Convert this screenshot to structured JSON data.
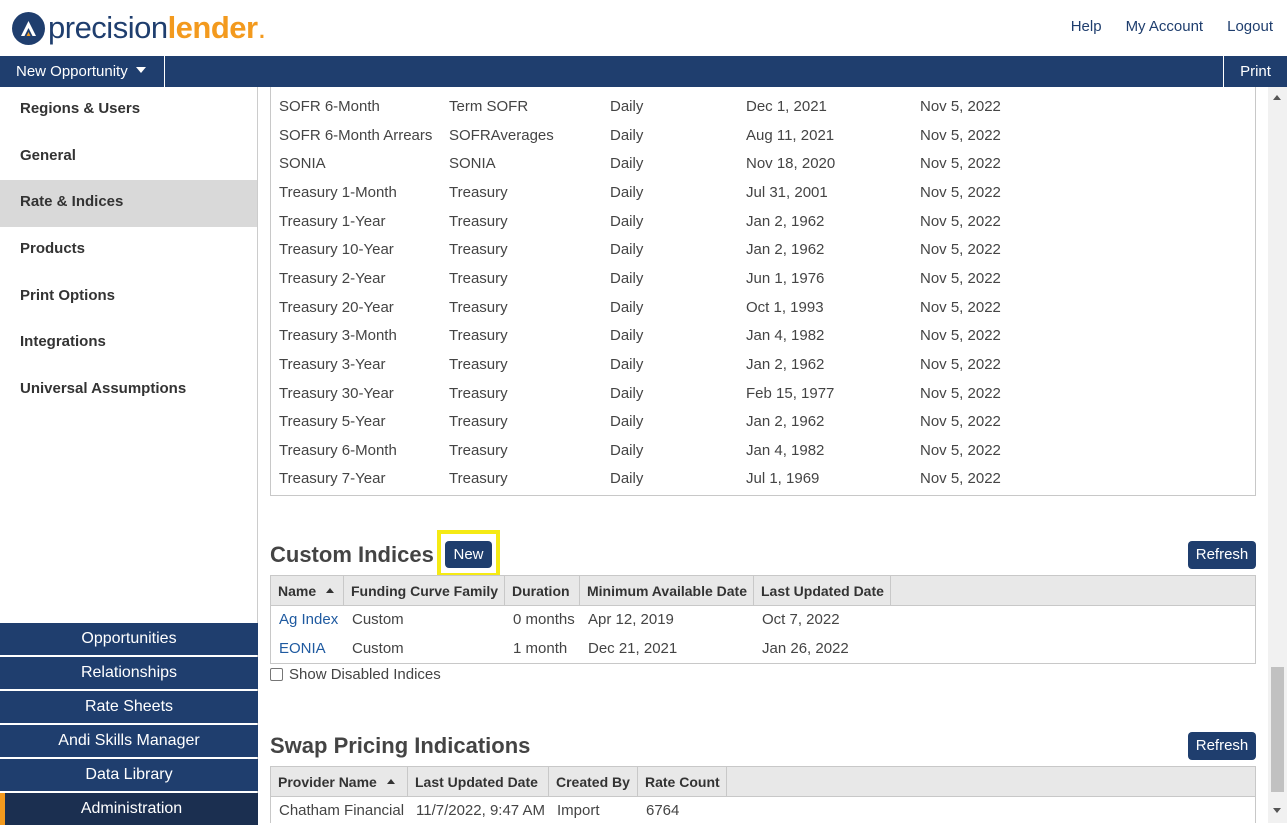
{
  "header": {
    "logo_part1": "precision",
    "logo_part2": "lender",
    "logo_dot": ".",
    "links": [
      "Help",
      "My Account",
      "Logout"
    ]
  },
  "navbar": {
    "opportunity_label": "New Opportunity",
    "print_label": "Print"
  },
  "sidebar": {
    "items": [
      {
        "label": "Regions & Users",
        "active": false
      },
      {
        "label": "General",
        "active": false
      },
      {
        "label": "Rate & Indices",
        "active": true
      },
      {
        "label": "Products",
        "active": false
      },
      {
        "label": "Print Options",
        "active": false
      },
      {
        "label": "Integrations",
        "active": false
      },
      {
        "label": "Universal Assumptions",
        "active": false
      }
    ],
    "bottom_nav": [
      "Opportunities",
      "Relationships",
      "Rate Sheets",
      "Andi Skills Manager",
      "Data Library",
      "Administration"
    ]
  },
  "standard_indices": {
    "rows": [
      [
        "SOFR 6-Month",
        "Term SOFR",
        "Daily",
        "Dec 1, 2021",
        "Nov 5, 2022"
      ],
      [
        "SOFR 6-Month Arrears",
        "SOFRAverages",
        "Daily",
        "Aug 11, 2021",
        "Nov 5, 2022"
      ],
      [
        "SONIA",
        "SONIA",
        "Daily",
        "Nov 18, 2020",
        "Nov 5, 2022"
      ],
      [
        "Treasury 1-Month",
        "Treasury",
        "Daily",
        "Jul 31, 2001",
        "Nov 5, 2022"
      ],
      [
        "Treasury 1-Year",
        "Treasury",
        "Daily",
        "Jan 2, 1962",
        "Nov 5, 2022"
      ],
      [
        "Treasury 10-Year",
        "Treasury",
        "Daily",
        "Jan 2, 1962",
        "Nov 5, 2022"
      ],
      [
        "Treasury 2-Year",
        "Treasury",
        "Daily",
        "Jun 1, 1976",
        "Nov 5, 2022"
      ],
      [
        "Treasury 20-Year",
        "Treasury",
        "Daily",
        "Oct 1, 1993",
        "Nov 5, 2022"
      ],
      [
        "Treasury 3-Month",
        "Treasury",
        "Daily",
        "Jan 4, 1982",
        "Nov 5, 2022"
      ],
      [
        "Treasury 3-Year",
        "Treasury",
        "Daily",
        "Jan 2, 1962",
        "Nov 5, 2022"
      ],
      [
        "Treasury 30-Year",
        "Treasury",
        "Daily",
        "Feb 15, 1977",
        "Nov 5, 2022"
      ],
      [
        "Treasury 5-Year",
        "Treasury",
        "Daily",
        "Jan 2, 1962",
        "Nov 5, 2022"
      ],
      [
        "Treasury 6-Month",
        "Treasury",
        "Daily",
        "Jan 4, 1982",
        "Nov 5, 2022"
      ],
      [
        "Treasury 7-Year",
        "Treasury",
        "Daily",
        "Jul 1, 1969",
        "Nov 5, 2022"
      ]
    ]
  },
  "custom_indices": {
    "title": "Custom Indices",
    "new_label": "New",
    "refresh_label": "Refresh",
    "columns": [
      "Name",
      "Funding Curve Family",
      "Duration",
      "Minimum Available Date",
      "Last Updated Date"
    ],
    "rows": [
      [
        "Ag Index",
        "Custom",
        "0 months",
        "Apr 12, 2019",
        "Oct 7, 2022"
      ],
      [
        "EONIA",
        "Custom",
        "1 month",
        "Dec 21, 2021",
        "Jan 26, 2022"
      ]
    ],
    "show_disabled_label": "Show Disabled Indices",
    "show_disabled_checked": false
  },
  "swap_pricing": {
    "title": "Swap Pricing Indications",
    "refresh_label": "Refresh",
    "columns": [
      "Provider Name",
      "Last Updated Date",
      "Created By",
      "Rate Count"
    ],
    "rows": [
      [
        "Chatham Financial",
        "11/7/2022, 9:47 AM",
        "Import",
        "6764"
      ]
    ]
  },
  "colors": {
    "brand_navy": "#1f3e6e",
    "brand_orange": "#f39a1e",
    "highlight": "#f5ea14"
  }
}
